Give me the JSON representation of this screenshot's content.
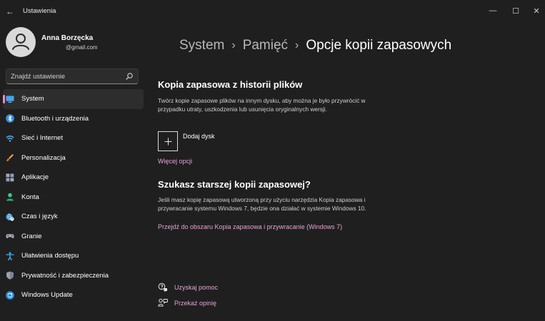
{
  "window": {
    "title": "Ustawienia",
    "back_glyph": "←",
    "minimize_glyph": "—",
    "maximize_glyph": "☐",
    "close_glyph": "✕"
  },
  "user": {
    "name": "Anna Borzęcka",
    "email": "@gmail.com"
  },
  "search": {
    "placeholder": "Znajdź ustawienie"
  },
  "sidebar": {
    "items": [
      {
        "label": "System",
        "icon": "monitor-icon",
        "active": true
      },
      {
        "label": "Bluetooth i urządzenia",
        "icon": "bluetooth-icon"
      },
      {
        "label": "Sieć i Internet",
        "icon": "wifi-icon"
      },
      {
        "label": "Personalizacja",
        "icon": "brush-icon"
      },
      {
        "label": "Aplikacje",
        "icon": "apps-icon"
      },
      {
        "label": "Konta",
        "icon": "person-icon"
      },
      {
        "label": "Czas i język",
        "icon": "globe-clock-icon"
      },
      {
        "label": "Granie",
        "icon": "gamepad-icon"
      },
      {
        "label": "Ułatwienia dostępu",
        "icon": "accessibility-icon"
      },
      {
        "label": "Prywatność i zabezpieczenia",
        "icon": "shield-icon"
      },
      {
        "label": "Windows Update",
        "icon": "update-icon"
      }
    ]
  },
  "breadcrumb": {
    "item1": "System",
    "item2": "Pamięć",
    "current": "Opcje kopii zapasowych",
    "separator": "›"
  },
  "file_history": {
    "heading": "Kopia zapasowa z historii plików",
    "description": "Twórz kopie zapasowe plików na innym dysku, aby można je było przywrócić w przypadku utraty, uszkodzenia lub usunięcia oryginalnych wersji.",
    "add_drive_label": "Dodaj dysk",
    "more_options_link": "Więcej opcji"
  },
  "older_backup": {
    "heading": "Szukasz starszej kopii zapasowej?",
    "description": "Jeśli masz kopię zapasową utworzoną przy użyciu narzędzia Kopia zapasowa i przywracanie systemu Windows 7, będzie ona działać w systemie Windows 10.",
    "link": "Przejdź do obszaru Kopia zapasowa i przywracanie (Windows 7)"
  },
  "help": {
    "get_help": "Uzyskaj pomoc",
    "feedback": "Przekaż opinię"
  },
  "colors": {
    "background": "#1f1f1f",
    "accent": "#e889c8",
    "link": "#e6a3d6"
  }
}
